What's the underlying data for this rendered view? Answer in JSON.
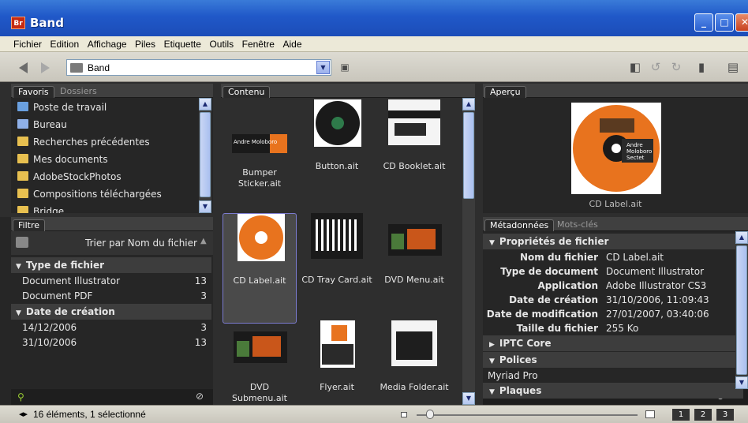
{
  "window": {
    "title": "Band",
    "app_icon_label": "Br"
  },
  "menu": [
    "Fichier",
    "Edition",
    "Affichage",
    "Piles",
    "Etiquette",
    "Outils",
    "Fenêtre",
    "Aide"
  ],
  "path": {
    "value": "Band"
  },
  "panels": {
    "favoris": {
      "tabs": [
        "Favoris",
        "Dossiers"
      ],
      "items": [
        {
          "label": "Poste de travail",
          "icon": "computer-icon",
          "color": "#6aa0e0"
        },
        {
          "label": "Bureau",
          "icon": "desktop-icon",
          "color": "#8fb0e8"
        },
        {
          "label": "Recherches précédentes",
          "icon": "folder-icon",
          "color": "#e8c050"
        },
        {
          "label": "Mes documents",
          "icon": "folder-icon",
          "color": "#e8c050"
        },
        {
          "label": "AdobeStockPhotos",
          "icon": "folder-icon",
          "color": "#e8c050"
        },
        {
          "label": "Compositions téléchargées",
          "icon": "folder-icon",
          "color": "#e8c050"
        },
        {
          "label": "Bridge",
          "icon": "folder-icon",
          "color": "#e8c050"
        }
      ]
    },
    "filtre": {
      "tab": "Filtre",
      "sort_label": "Trier par Nom du fichier",
      "sections": [
        {
          "title": "Type de fichier",
          "rows": [
            {
              "label": "Document Illustrator",
              "count": "13"
            },
            {
              "label": "Document PDF",
              "count": "3"
            }
          ]
        },
        {
          "title": "Date de création",
          "rows": [
            {
              "label": "14/12/2006",
              "count": "3"
            },
            {
              "label": "31/10/2006",
              "count": "13"
            }
          ]
        }
      ]
    },
    "contenu": {
      "tab": "Contenu",
      "items": [
        {
          "caption": "Bumper Sticker.ait",
          "kind": "sticker",
          "selected": false
        },
        {
          "caption": "Button.ait",
          "kind": "button",
          "selected": false
        },
        {
          "caption": "CD Booklet.ait",
          "kind": "booklet",
          "selected": false
        },
        {
          "caption": "CD Label.ait",
          "kind": "cdlabel",
          "selected": true
        },
        {
          "caption": "CD Tray Card.ait",
          "kind": "tray",
          "selected": false
        },
        {
          "caption": "DVD Menu.ait",
          "kind": "dvd",
          "selected": false
        },
        {
          "caption": "DVD Submenu.ait",
          "kind": "dvd",
          "selected": false
        },
        {
          "caption": "Flyer.ait",
          "kind": "flyer",
          "selected": false
        },
        {
          "caption": "Media Folder.ait",
          "kind": "folder",
          "selected": false
        }
      ],
      "sticker_text": "Andre Moloboro"
    },
    "apercu": {
      "tab": "Aperçu",
      "caption": "CD Label.ait",
      "disc_text": "Andre Moloboro Sectet"
    },
    "metadata": {
      "tabs": [
        "Métadonnées",
        "Mots-clés"
      ],
      "sections": [
        {
          "title": "Propriétés de fichier",
          "expanded": true,
          "rows": [
            {
              "key": "Nom du fichier",
              "value": "CD Label.ait"
            },
            {
              "key": "Type de document",
              "value": "Document Illustrator"
            },
            {
              "key": "Application",
              "value": "Adobe Illustrator CS3"
            },
            {
              "key": "Date de création",
              "value": "31/10/2006, 11:09:43"
            },
            {
              "key": "Date de modification",
              "value": "27/01/2007, 03:40:06"
            },
            {
              "key": "Taille du fichier",
              "value": "255 Ko"
            }
          ]
        },
        {
          "title": "IPTC Core",
          "expanded": false,
          "rows": []
        },
        {
          "title": "Polices",
          "expanded": true,
          "rows": [
            {
              "key": "",
              "value": "Myriad Pro"
            }
          ]
        },
        {
          "title": "Plaques",
          "expanded": true,
          "rows": []
        }
      ]
    }
  },
  "status": {
    "text": "16 éléments, 1 sélectionné"
  },
  "view_buttons": [
    "1",
    "2",
    "3"
  ],
  "colors": {
    "orange": "#e8731e",
    "panel_bg": "#262626",
    "title_blue": "#2058c8"
  }
}
